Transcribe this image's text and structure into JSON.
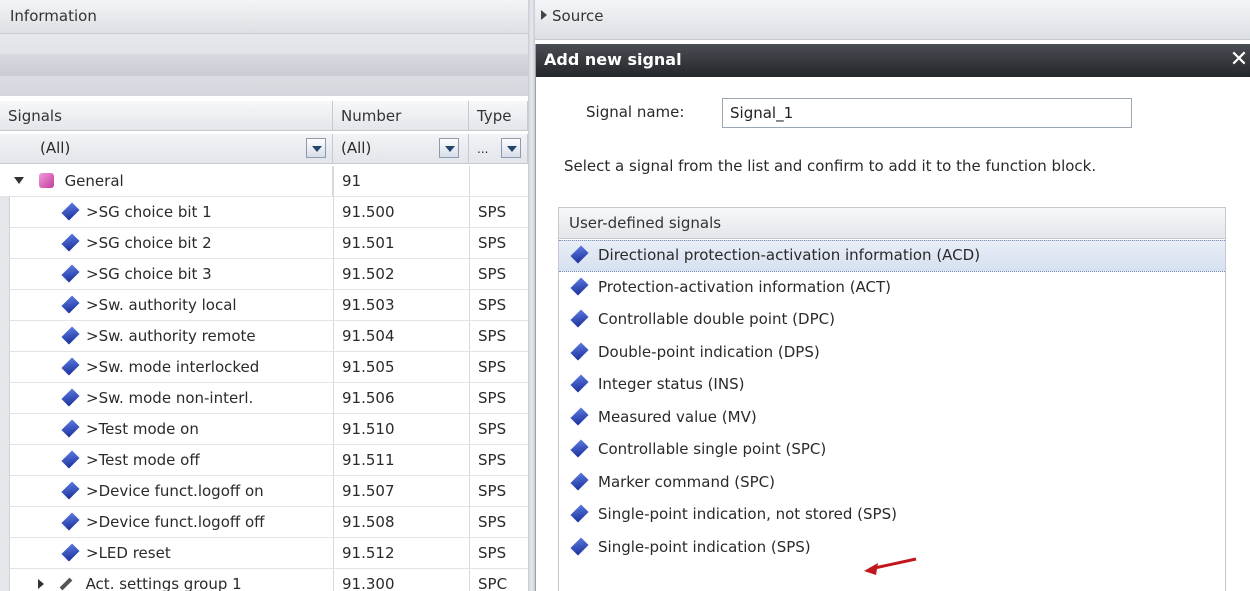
{
  "left_panel": {
    "header": "Information",
    "columns": {
      "signals": "Signals",
      "number": "Number",
      "type": "Type"
    },
    "filters": {
      "signals": "(All)",
      "number": "(All)",
      "type": "..."
    },
    "group": {
      "name": "General",
      "number": "91"
    },
    "rows": [
      {
        "name": ">SG choice bit 1",
        "number": "91.500",
        "type": "SPS"
      },
      {
        "name": ">SG choice bit 2",
        "number": "91.501",
        "type": "SPS"
      },
      {
        "name": ">SG choice bit 3",
        "number": "91.502",
        "type": "SPS"
      },
      {
        "name": ">Sw. authority local",
        "number": "91.503",
        "type": "SPS"
      },
      {
        "name": ">Sw. authority remote",
        "number": "91.504",
        "type": "SPS"
      },
      {
        "name": ">Sw. mode interlocked",
        "number": "91.505",
        "type": "SPS"
      },
      {
        "name": ">Sw. mode non-interl.",
        "number": "91.506",
        "type": "SPS"
      },
      {
        "name": ">Test mode on",
        "number": "91.510",
        "type": "SPS"
      },
      {
        "name": ">Test mode off",
        "number": "91.511",
        "type": "SPS"
      },
      {
        "name": ">Device funct.logoff on",
        "number": "91.507",
        "type": "SPS"
      },
      {
        "name": ">Device funct.logoff off",
        "number": "91.508",
        "type": "SPS"
      },
      {
        "name": ">LED reset",
        "number": "91.512",
        "type": "SPS"
      }
    ],
    "next_group": {
      "name": "Act. settings group 1",
      "number": "91.300",
      "type": "SPC"
    }
  },
  "source_bar": {
    "label": "Source"
  },
  "dialog": {
    "title": "Add new signal",
    "close": "✕",
    "signal_name_label": "Signal name:",
    "signal_name_value": "Signal_1",
    "instruction": "Select a signal from the list and confirm to add it to the function block.",
    "list_header": "User-defined signals",
    "items": [
      "Directional protection-activation information (ACD)",
      "Protection-activation information (ACT)",
      "Controllable double point (DPC)",
      "Double-point indication (DPS)",
      "Integer status (INS)",
      "Measured value (MV)",
      "Controllable single point (SPC)",
      "Marker command (SPC)",
      "Single-point indication, not stored (SPS)",
      "Single-point indication (SPS)"
    ],
    "selected_index": 0
  },
  "colors": {
    "accent_arrow": "#c0161c",
    "title_bar": "#2b2e33",
    "signal_icon": "#1b2f9c"
  }
}
